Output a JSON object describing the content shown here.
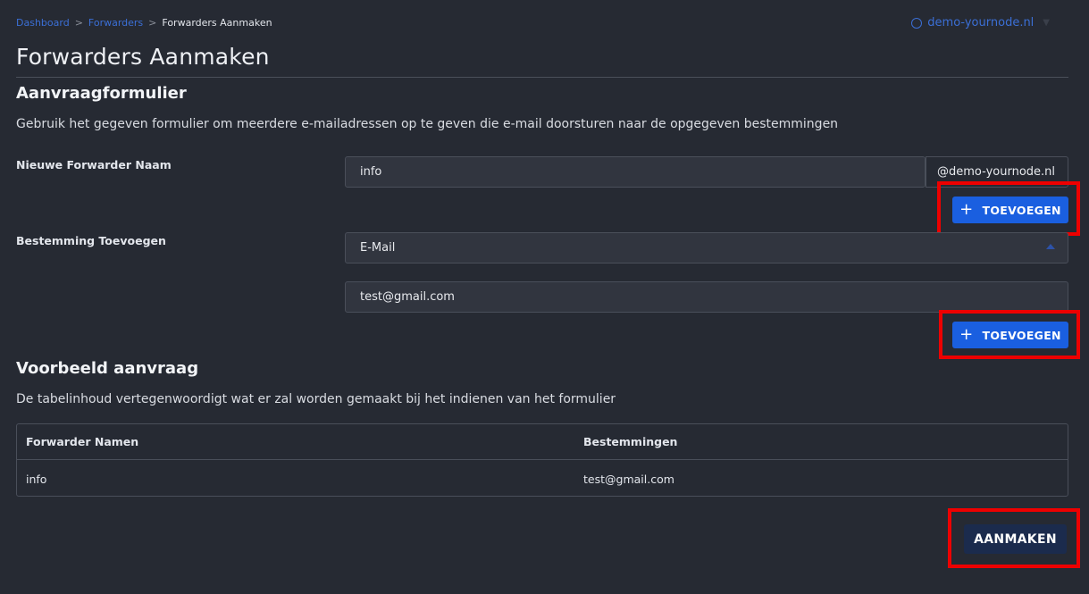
{
  "breadcrumb": {
    "items": [
      "Dashboard",
      "Forwarders"
    ],
    "current": "Forwarders Aanmaken",
    "separator": ">"
  },
  "domain_selector": {
    "label": "demo-yournode.nl",
    "icon": "globe-icon"
  },
  "page_title": "Forwarders Aanmaken",
  "form": {
    "title": "Aanvraagformulier",
    "description": "Gebruik het gegeven formulier om meerdere e-mailadressen op te geven die e-mail doorsturen naar de opgegeven bestemmingen",
    "forwarder_name": {
      "label": "Nieuwe Forwarder Naam",
      "value": "info",
      "domain_suffix": "@demo-yournode.nl",
      "add_button": "TOEVOEGEN"
    },
    "destination": {
      "label": "Bestemming Toevoegen",
      "type_value": "E-Mail",
      "email_value": "test@gmail.com",
      "add_button": "TOEVOEGEN"
    }
  },
  "preview": {
    "title": "Voorbeeld aanvraag",
    "description": "De tabelinhoud vertegenwoordigt wat er zal worden gemaakt bij het indienen van het formulier",
    "columns": [
      "Forwarder Namen",
      "Bestemmingen"
    ],
    "rows": [
      [
        "info",
        "test@gmail.com"
      ]
    ]
  },
  "submit_button": "AANMAKEN",
  "colors": {
    "background": "#262a33",
    "primary_button": "#1a5fe0",
    "submit_button": "#1b2b4d",
    "highlight": "#ee0000",
    "link": "#3b6fd6"
  }
}
